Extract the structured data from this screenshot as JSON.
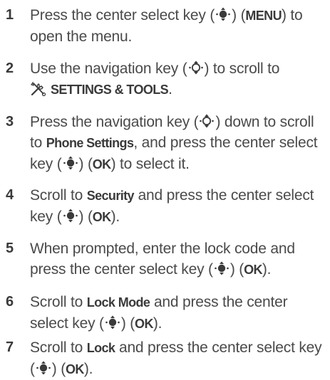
{
  "steps": [
    {
      "number": "1",
      "p1": "Press the center select key (",
      "p2": ") (",
      "key_label": "MENU",
      "p3": ") to open the menu."
    },
    {
      "number": "2",
      "p1": "Use the navigation key (",
      "p2": ") to scroll to",
      "target_label": "SETTINGS & TOOLS",
      "p3": "."
    },
    {
      "number": "3",
      "p1": "Press the navigation key (",
      "p2": ") down to scroll to ",
      "target_label": "Phone Settings",
      "p3": ", and press the center select key (",
      "p4": ") (",
      "key_label": "OK",
      "p5": ") to select it."
    },
    {
      "number": "4",
      "p1": "Scroll to ",
      "target_label": "Security",
      "p2": " and press the center select key (",
      "p3": ") (",
      "key_label": "OK",
      "p4": ")."
    },
    {
      "number": "5",
      "p1": "When prompted, enter the lock code and press the center select key (",
      "p2": ") (",
      "key_label": "OK",
      "p3": ")."
    },
    {
      "number": "6",
      "p1": "Scroll to ",
      "target_label": "Lock Mode",
      "p2": " and press the center select key (",
      "p3": ") (",
      "key_label": "OK",
      "p4": ")."
    },
    {
      "number": "7",
      "p1": "Scroll to ",
      "target_label": "Lock",
      "p2": " and press the center select key (",
      "p3": ") (",
      "key_label": "OK",
      "p4": ")."
    }
  ],
  "icons": {
    "select_key": "center-select-key-icon",
    "nav_key": "navigation-key-icon",
    "tools": "settings-tools-icon"
  },
  "colors": {
    "text": "#4a4a4a"
  }
}
